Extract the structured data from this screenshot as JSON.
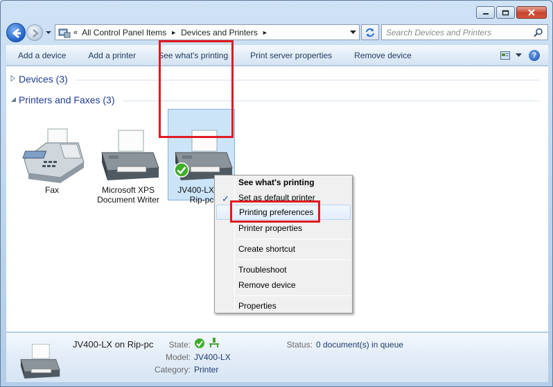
{
  "window": {
    "controls": {
      "minimize": "minimize",
      "maximize": "maximize",
      "close": "close"
    }
  },
  "address": {
    "chevron": "«",
    "crumbs": [
      "All Control Panel Items",
      "Devices and Printers"
    ],
    "separator": "►"
  },
  "search": {
    "placeholder": "Search Devices and Printers"
  },
  "commands": [
    "Add a device",
    "Add a printer",
    "See what's printing",
    "Print server properties",
    "Remove device"
  ],
  "groups": {
    "devices": {
      "label": "Devices (3)"
    },
    "printers": {
      "label": "Printers and Faxes (3)"
    }
  },
  "printers": [
    {
      "name_line1": "Fax",
      "name_line2": ""
    },
    {
      "name_line1": "Microsoft XPS",
      "name_line2": "Document Writer"
    },
    {
      "name_line1": "JV400-LX on",
      "name_line2": "Rip-pc"
    }
  ],
  "context_menu": {
    "items": [
      {
        "label": "See what's printing",
        "bold": true
      },
      {
        "label": "Set as default printer",
        "checked": true
      },
      {
        "label": "Printing preferences",
        "highlighted": true
      },
      {
        "label": "Printer properties"
      },
      {
        "label": "Create shortcut"
      },
      {
        "label": "Troubleshoot"
      },
      {
        "label": "Remove device"
      },
      {
        "label": "Properties"
      }
    ]
  },
  "details": {
    "title": "JV400-LX on Rip-pc",
    "state_label": "State:",
    "model_label": "Model:",
    "model_value": "JV400-LX",
    "category_label": "Category:",
    "category_value": "Printer",
    "status_label": "Status:",
    "status_value": "0 document(s) in queue"
  },
  "colors": {
    "highlight_box": "#e01a22",
    "link_blue": "#1f3a93"
  }
}
